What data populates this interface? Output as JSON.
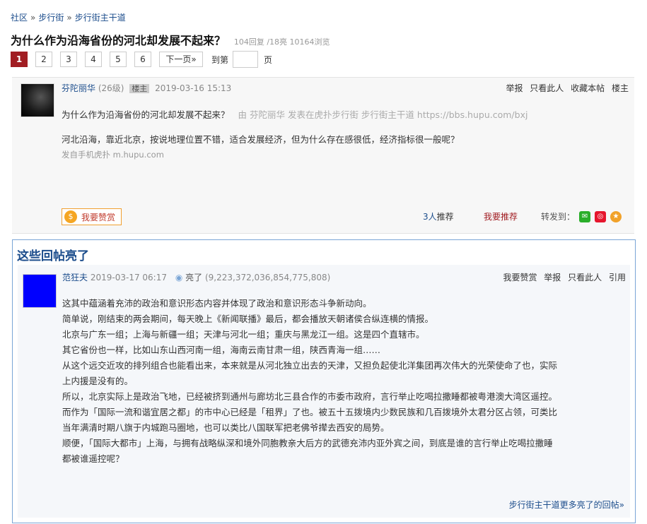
{
  "breadcrumb": {
    "items": [
      "社区",
      "步行街",
      "步行街主干道"
    ],
    "separator": "»"
  },
  "thread": {
    "title": "为什么作为沿海省份的河北却发展不起来？",
    "stats": "104回复 /18亮  10164浏览"
  },
  "pager": {
    "pages": [
      "1",
      "2",
      "3",
      "4",
      "5",
      "6"
    ],
    "active": "1",
    "next_label": "下一页»",
    "jump_label": "到第",
    "jump_value": "",
    "page_suffix": "页"
  },
  "op": {
    "author": "芬陀丽华",
    "level": "(26级)",
    "badge": "楼主",
    "time": "2019-03-16 15:13",
    "tools": [
      "举报",
      "只看此人",
      "收藏本帖",
      "楼主"
    ],
    "quote_title": "为什么作为沿海省份的河北却发展不起来？",
    "quote_source": "由 芬陀丽华 发表在虎扑步行街 步行街主干道 https://bbs.hupu.com/bxj",
    "body": "河北沿海，靠近北京，按说地理位置不错，适合发展经济，但为什么存在感很低，经济指标很一般呢？",
    "from": "发自手机虎扑 m.hupu.com",
    "reward_label": "我要赞赏",
    "recommend_count": "3人",
    "recommend_suffix": "推荐",
    "recommend_button": "我要推荐",
    "share_label": "转发到："
  },
  "hot": {
    "section_title": "这些回帖亮了",
    "author": "范狂夫",
    "time": "2019-03-17 06:17",
    "light_label": "亮了",
    "light_count": "(9,223,372,036,854,775,808)",
    "tools": [
      "我要赞赏",
      "举报",
      "只看此人",
      "引用"
    ],
    "lines": [
      "这其中蕴涵着充沛的政治和意识形态内容并体现了政治和意识形态斗争新动向。",
      "简单说，刚结束的两会期间，每天晚上《新闻联播》最后，都会播放天朝诸侯合纵连横的情报。",
      "北京与广东一组；上海与新疆一组；天津与河北一组；重庆与黑龙江一组。这是四个直辖市。",
      "其它省份也一样，比如山东山西河南一组，海南云南甘肃一组，陕西青海一组……",
      "从这个远交近攻的排列组合也能看出来，本来就是从河北独立出去的天津，又担负起使北洋集团再次伟大的光荣使命了也，实际",
      "上内援是没有的。",
      "所以，北京实际上是政治飞地，已经被挤到通州与廊坊北三县合作的市委市政府，言行举止吃喝拉撒睡都被粤港澳大湾区遥控。",
      "而作为「国际一流和谐宜居之都」的市中心已经是「租界」了也。被五十五拨境内少数民族和几百拨境外太君分区占领，可类比",
      "当年满清时期八旗于内城跑马圈地，也可以类比八国联军把老佛爷撵去西安的局势。",
      "顺便，「国际大都市」上海，与拥有战略纵深和境外同胞教亲大后方的武德充沛内亚外宾之间，到底是谁的言行举止吃喝拉撒睡",
      "都被谁遥控呢？"
    ],
    "more_link": "步行街主干道更多亮了的回帖»"
  },
  "colors": {
    "link": "#1c4d8c",
    "active_page": "#a11d22",
    "hot_border": "#7aa5d6"
  }
}
